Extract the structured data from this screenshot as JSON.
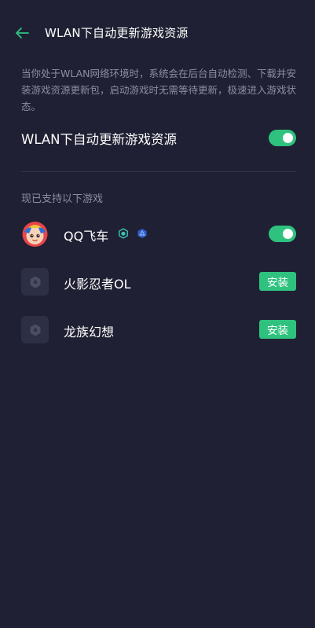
{
  "header": {
    "title": "WLAN下自动更新游戏资源",
    "back_icon": "back-arrow-icon"
  },
  "description": "当你处于WLAN网络环境时，系统会在后台自动检测、下载并安装游戏资源更新包，启动游戏时无需等待更新，极速进入游戏状态。",
  "main_setting": {
    "label": "WLAN下自动更新游戏资源",
    "enabled": true
  },
  "section_label": "现已支持以下游戏",
  "games": [
    {
      "name": "QQ飞车",
      "action": "toggle",
      "enabled": true,
      "badges": [
        "hexagon-badge-icon",
        "shield-badge-icon"
      ]
    },
    {
      "name": "火影忍者OL",
      "action": "install",
      "install_label": "安装"
    },
    {
      "name": "龙族幻想",
      "action": "install",
      "install_label": "安装"
    }
  ],
  "colors": {
    "background": "#1f2033",
    "accent": "#2ec27e",
    "secondary_text": "#8c8ea3",
    "placeholder_icon_bg": "#2d3045"
  }
}
